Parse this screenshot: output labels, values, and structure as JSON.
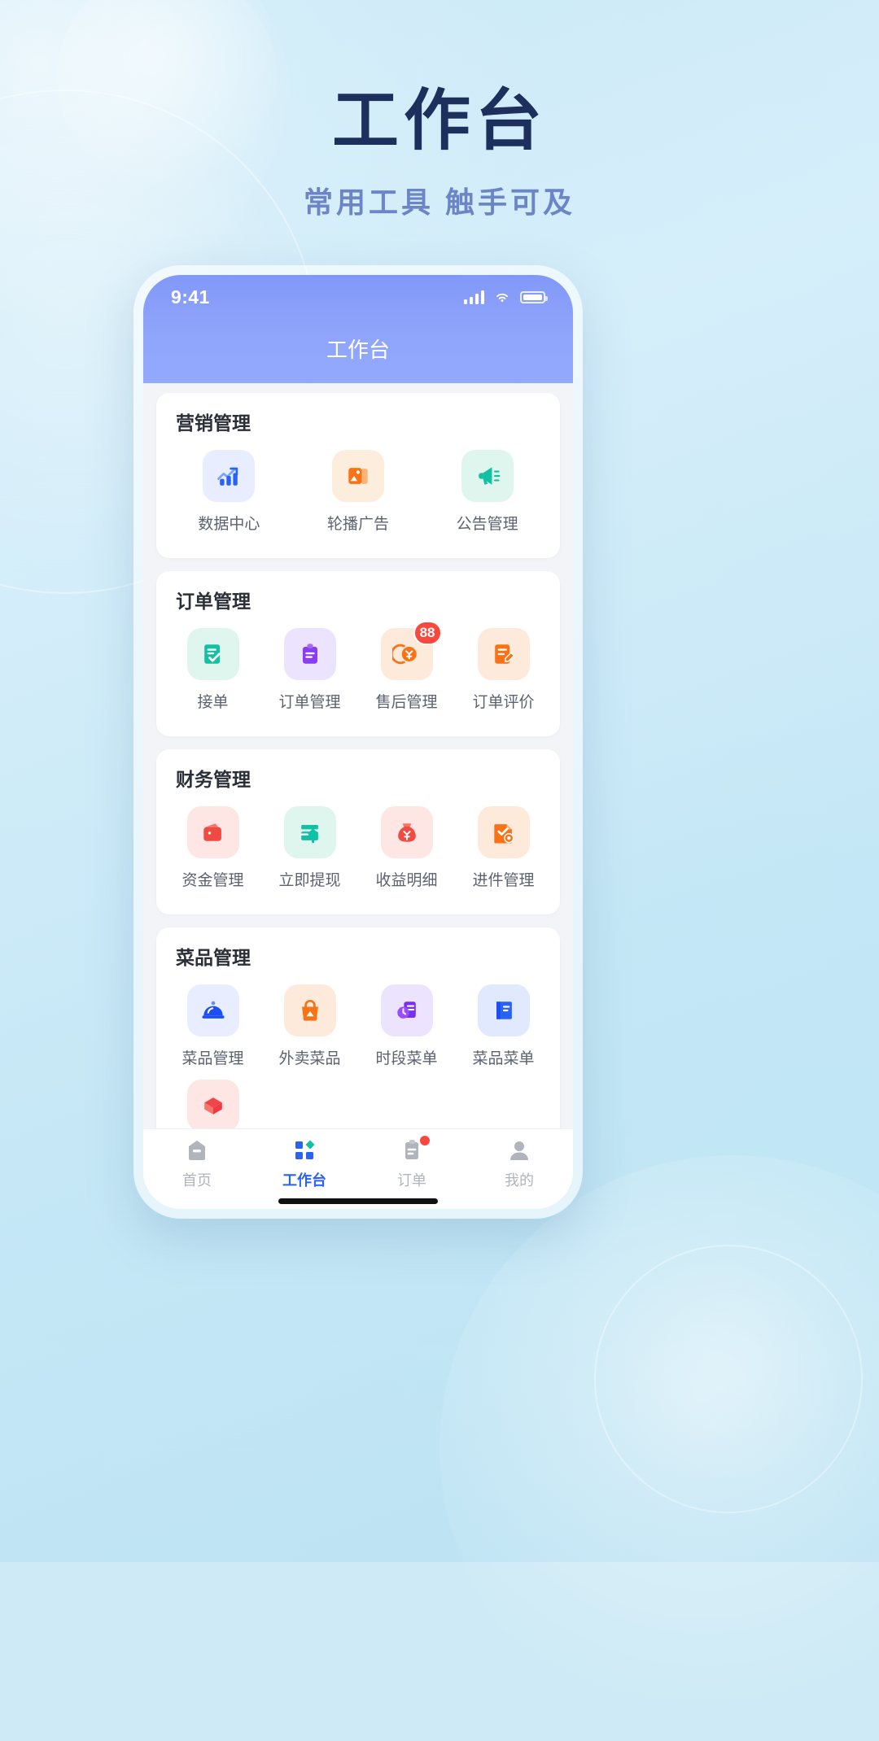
{
  "hero": {
    "title": "工作台",
    "subtitle": "常用工具  触手可及"
  },
  "phone": {
    "statusbar": {
      "time": "9:41",
      "signal_icon": "signal-bars-icon",
      "wifi_icon": "wifi-icon",
      "battery_icon": "battery-icon"
    },
    "nav_title": "工作台"
  },
  "sections": [
    {
      "title": "营销管理",
      "items": [
        {
          "label": "数据中心",
          "icon": "chart-growth-icon",
          "bg": "#e8eeff",
          "fg": "#2b62f6"
        },
        {
          "label": "轮播广告",
          "icon": "image-banner-icon",
          "bg": "#fdeddd",
          "fg": "#f97316"
        },
        {
          "label": "公告管理",
          "icon": "megaphone-icon",
          "bg": "#dff6ef",
          "fg": "#18c2a4"
        }
      ]
    },
    {
      "title": "订单管理",
      "items": [
        {
          "label": "接单",
          "icon": "order-accept-icon",
          "bg": "#dff6ef",
          "fg": "#18c2a4"
        },
        {
          "label": "订单管理",
          "icon": "clipboard-icon",
          "bg": "#ece4fe",
          "fg": "#8b3df5"
        },
        {
          "label": "售后管理",
          "icon": "refund-yuan-icon",
          "bg": "#fdeadb",
          "fg": "#f97316",
          "badge": "88"
        },
        {
          "label": "订单评价",
          "icon": "review-edit-icon",
          "bg": "#fdeadb",
          "fg": "#f97316"
        }
      ]
    },
    {
      "title": "财务管理",
      "items": [
        {
          "label": "资金管理",
          "icon": "wallet-icon",
          "bg": "#fde6e4",
          "fg": "#f04b42"
        },
        {
          "label": "立即提现",
          "icon": "withdraw-card-icon",
          "bg": "#dff6ef",
          "fg": "#0fc2a7"
        },
        {
          "label": "收益明细",
          "icon": "money-bag-icon",
          "bg": "#fde6e4",
          "fg": "#f04b42"
        },
        {
          "label": "进件管理",
          "icon": "doc-check-icon",
          "bg": "#fdeadb",
          "fg": "#f97316"
        }
      ]
    },
    {
      "title": "菜品管理",
      "items": [
        {
          "label": "菜品管理",
          "icon": "cloche-icon",
          "bg": "#e8eeff",
          "fg": "#1d4ef5"
        },
        {
          "label": "外卖菜品",
          "icon": "takeaway-bag-icon",
          "bg": "#fdeadb",
          "fg": "#f97316"
        },
        {
          "label": "时段菜单",
          "icon": "time-menu-icon",
          "bg": "#ece4fe",
          "fg": "#8b3df5"
        },
        {
          "label": "菜品菜单",
          "icon": "menu-book-icon",
          "bg": "#e0e9fe",
          "fg": "#2b62f6"
        },
        {
          "label": "",
          "icon": "package-box-icon",
          "bg": "#fde6e4",
          "fg": "#f0464b"
        }
      ]
    }
  ],
  "tabbar": {
    "items": [
      {
        "label": "首页",
        "icon": "home-icon",
        "active": false
      },
      {
        "label": "工作台",
        "icon": "workbench-grid-icon",
        "active": true
      },
      {
        "label": "订单",
        "icon": "order-list-icon",
        "active": false,
        "dot": true
      },
      {
        "label": "我的",
        "icon": "user-profile-icon",
        "active": false
      }
    ]
  },
  "colors": {
    "accent": "#2b62f6",
    "nav_gradient_start": "#8298f8",
    "nav_gradient_end": "#93a9fd",
    "badge": "#f8483f",
    "hero_title": "#1d2f5c",
    "hero_subtitle": "#6c85c6"
  }
}
